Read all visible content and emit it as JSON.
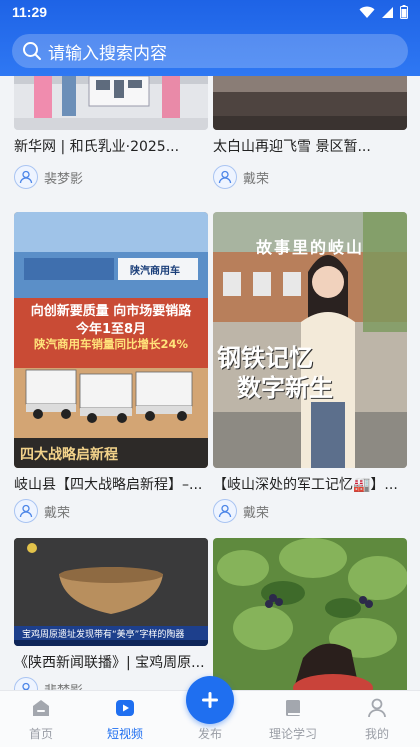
{
  "status": {
    "time": "11:29"
  },
  "search": {
    "placeholder": "请输入搜索内容"
  },
  "cards": [
    {
      "title": "新华网 | 和氏乳业·2025...",
      "author": "裴梦影"
    },
    {
      "title": "太白山再迎飞雪 景区暂...",
      "author": "戴荣"
    },
    {
      "title": "岐山县【四大战略启新程】–...",
      "author": "戴荣",
      "overlay": {
        "brand": "陕汽商用车",
        "line1": "向创新要质量 向市场要销路",
        "line2": "今年1至8月",
        "line3": "陕汽商用车销量同比增长24%",
        "bottom": "四大战略启新程"
      }
    },
    {
      "title": "【岐山深处的军工记忆🏭】...",
      "author": "戴荣",
      "overlay": {
        "top": "故事里的岐山",
        "line1": "钢铁记忆",
        "line2": "数字新生"
      }
    },
    {
      "title": "《陕西新闻联播》| 宝鸡周原...",
      "author": "裴梦影",
      "overlay": {
        "ticker": "宝鸡周原遗址发现带有“美亭”字样的陶器"
      }
    },
    {
      "title": "",
      "author": ""
    }
  ],
  "tabs": [
    {
      "label": "首页",
      "icon": "home-icon"
    },
    {
      "label": "短视频",
      "icon": "video-icon"
    },
    {
      "label": "发布",
      "icon": "plus-icon"
    },
    {
      "label": "理论学习",
      "icon": "book-icon"
    },
    {
      "label": "我的",
      "icon": "user-icon"
    }
  ],
  "colors": {
    "accent": "#1f6ff0",
    "header": "#2a70ee"
  }
}
